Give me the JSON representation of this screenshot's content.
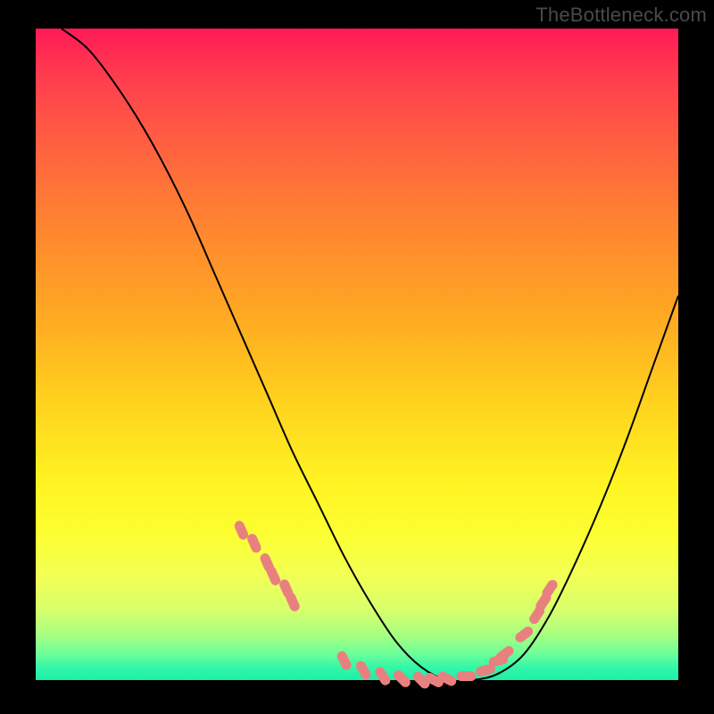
{
  "watermark": "TheBottleneck.com",
  "chart_data": {
    "type": "line",
    "title": "",
    "xlabel": "",
    "ylabel": "",
    "xlim": [
      0,
      100
    ],
    "ylim": [
      0,
      100
    ],
    "series": [
      {
        "name": "curve",
        "color": "#000000",
        "x": [
          4,
          8,
          12,
          16,
          20,
          24,
          28,
          32,
          36,
          40,
          44,
          48,
          52,
          56,
          60,
          64,
          68,
          72,
          76,
          80,
          84,
          88,
          92,
          96,
          100
        ],
        "y": [
          100,
          97,
          92,
          86,
          79,
          71,
          62,
          53,
          44,
          35,
          27,
          19,
          12,
          6,
          2,
          0,
          0,
          1,
          4,
          10,
          18,
          27,
          37,
          48,
          59
        ]
      },
      {
        "name": "markers",
        "color": "#e98080",
        "type": "scatter",
        "x": [
          32,
          34,
          36,
          37,
          39,
          40,
          48,
          51,
          54,
          57,
          60,
          62,
          64,
          67,
          70,
          72,
          73,
          76,
          78,
          79,
          80
        ],
        "y": [
          23,
          21,
          18,
          16,
          14,
          12,
          3,
          1.5,
          0.6,
          0.2,
          0.0,
          0.0,
          0.2,
          0.6,
          1.5,
          3,
          4,
          7,
          10,
          12,
          14
        ]
      }
    ]
  }
}
